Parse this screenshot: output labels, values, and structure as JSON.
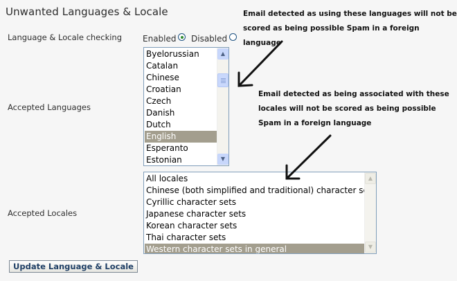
{
  "page": {
    "title": "Unwanted Languages & Locale"
  },
  "checking": {
    "label": "Language & Locale checking",
    "enabled_label": "Enabled",
    "disabled_label": "Disabled",
    "selected": "Enabled"
  },
  "languages": {
    "label": "Accepted Languages",
    "visible_options": [
      "Byelorussian",
      "Catalan",
      "Chinese",
      "Croatian",
      "Czech",
      "Danish",
      "Dutch",
      "English",
      "Esperanto",
      "Estonian"
    ],
    "selected": "English"
  },
  "locales": {
    "label": "Accepted Locales",
    "visible_options": [
      "All locales",
      "Chinese (both simplified and traditional) character sets",
      "Cyrillic character sets",
      "Japanese character sets",
      "Korean character sets",
      "Thai character sets",
      "Western character sets in general"
    ],
    "selected": "Western character sets in general"
  },
  "annotations": {
    "top": [
      "Email detected as using these languages will not be",
      "scored as being possible Spam in a foreign language"
    ],
    "middle": [
      "Email detected as being associated with these",
      "locales will not be scored as being possible",
      "Spam in a foreign language"
    ]
  },
  "submit_label": "Update Language & Locale",
  "colors": {
    "selected_row": "#a39e8e",
    "list_border": "#7f9db9",
    "button_text": "#1f3f66"
  }
}
